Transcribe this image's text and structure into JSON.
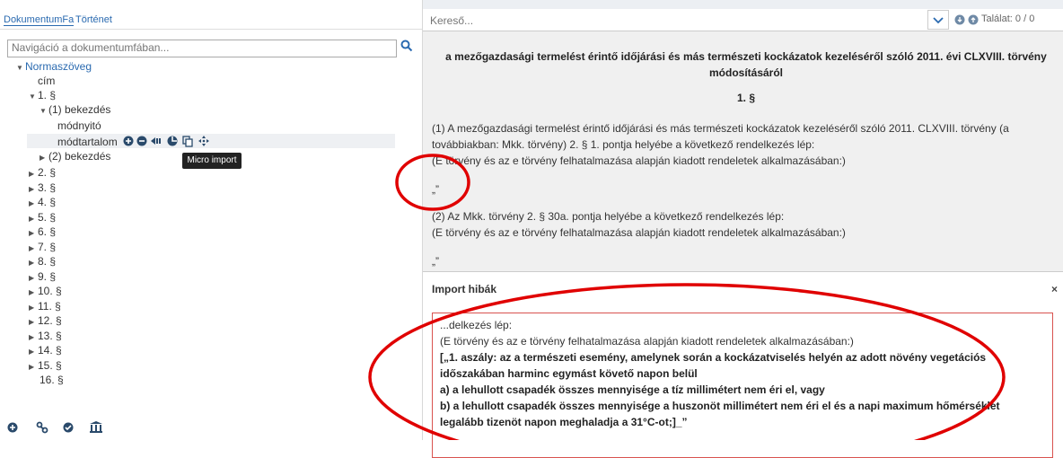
{
  "left_panel": {
    "tabs": [
      "DokumentumFa",
      "Történet"
    ],
    "nav_placeholder": "Navigáció a dokumentumfában...",
    "tree": {
      "root": "Normaszöveg",
      "cim": "cím",
      "sec1": "1. §",
      "par1": "(1) bekezdés",
      "modnyito": "módnyitó",
      "modtartalom": "módtartalom",
      "par2": "(2) bekezdés",
      "sections": [
        "2. §",
        "3. §",
        "4. §",
        "5. §",
        "6. §",
        "7. §",
        "8. §",
        "9. §",
        "10. §",
        "11. §",
        "12. §",
        "13. §",
        "14. §",
        "15. §",
        "16. §"
      ]
    },
    "tooltip": "Micro import"
  },
  "right_panel": {
    "search_placeholder": "Kereső...",
    "hits": "Találat: 0 / 0",
    "doc_title_l1": "a mezőgazdasági termelést érintő időjárási és más természeti kockázatok kezeléséről szóló 2011. évi CLXVIII. törvény",
    "doc_title_l2": "módosításáról",
    "section_heading": "1. §",
    "p1_l1": "(1) A mezőgazdasági termelést érintő időjárási és más természeti kockázatok kezeléséről szóló 2011. CLXVIII. törvény (a",
    "p1_l2": "továbbiakban: Mkk. törvény) 2. § 1. pontja helyébe a következő rendelkezés lép:",
    "p1_l3": "(E törvény és az e törvény felhatalmazása alapján kiadott rendeletek alkalmazásában:)",
    "quote1": "„”",
    "p2_l1": "(2) Az Mkk. törvény 2. § 30a. pontja helyébe a következő rendelkezés lép:",
    "p2_l2": "(E törvény és az e törvény felhatalmazása alapján kiadott rendeletek alkalmazásában:)",
    "quote2": "„”",
    "errors": {
      "title": "Import hibák",
      "close": "×",
      "lines": [
        "...delkezés lép:",
        "(E törvény és az e törvény felhatalmazása alapján kiadott rendeletek alkalmazásában:)",
        "[„1. aszály: az a természeti esemény, amelynek során a kockázatviselés helyén az adott növény vegetációs",
        "időszakában harminc egymást követő napon belül",
        "a) a lehullott csapadék összes mennyisége a tíz millimétert nem éri el, vagy",
        "b) a lehullott csapadék összes mennyisége a huszonöt millimétert nem éri el és a napi maximum hőmérséklet",
        "legalább tizenöt napon meghaladja a 31°C-ot;]_”"
      ]
    }
  },
  "colors": {
    "accent": "#2a6ab0",
    "error": "#d9534f",
    "annotation": "#e00000"
  }
}
